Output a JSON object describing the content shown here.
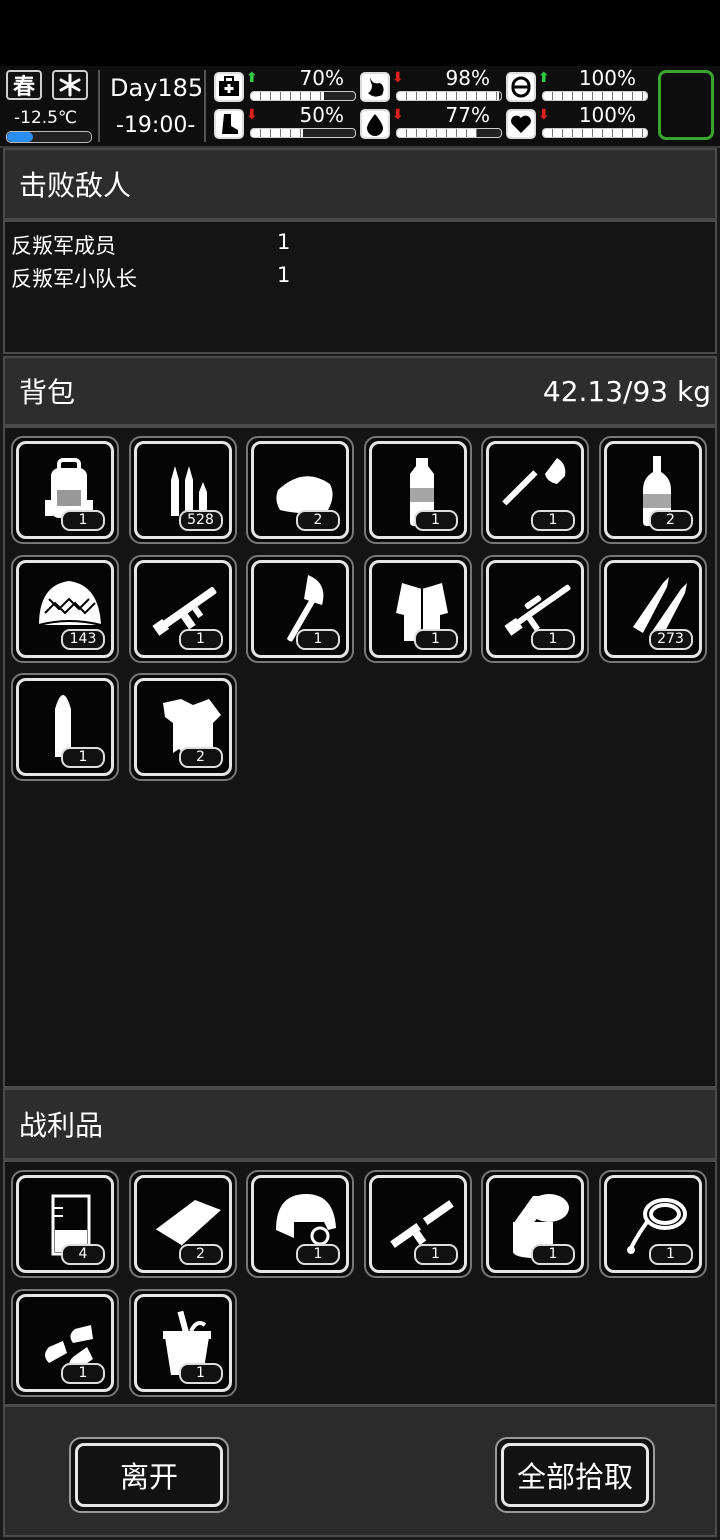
{
  "status": {
    "season": "春",
    "weather_icon": "snowflake-icon",
    "temperature": "-12.5℃",
    "day": "Day185",
    "time": "-19:00-",
    "stats": [
      {
        "icon": "medkit-icon",
        "trend": "up",
        "value": "70%",
        "level": 0.7
      },
      {
        "icon": "stomach-icon",
        "trend": "down",
        "value": "98%",
        "level": 0.98
      },
      {
        "icon": "pill-icon",
        "trend": "up",
        "value": "100%",
        "level": 1.0
      },
      {
        "icon": "boot-icon",
        "trend": "down",
        "value": "50%",
        "level": 0.5
      },
      {
        "icon": "water-drop-icon",
        "trend": "down",
        "value": "77%",
        "level": 0.77
      },
      {
        "icon": "heart-icon",
        "trend": "down",
        "value": "100%",
        "level": 1.0
      }
    ],
    "colors": {
      "up": "#2ecc40",
      "down": "#e0201c",
      "equip_border": "#3aa52e",
      "temp_fill": "#2c8df0"
    }
  },
  "defeated": {
    "title": "击败敌人",
    "enemies": [
      {
        "name": "反叛军成员",
        "count": "1"
      },
      {
        "name": "反叛军小队长",
        "count": "1"
      }
    ]
  },
  "backpack": {
    "title": "背包",
    "weight": "42.13/93 kg",
    "items": [
      {
        "icon": "backpack-icon",
        "count": "1"
      },
      {
        "icon": "rifle-ammo-icon",
        "count": "528"
      },
      {
        "icon": "bread-icon",
        "count": "2"
      },
      {
        "icon": "water-bottle-icon",
        "count": "1"
      },
      {
        "icon": "shovel-icon",
        "count": "1"
      },
      {
        "icon": "liquor-bottle-icon",
        "count": "2"
      },
      {
        "icon": "camo-net-helmet-icon",
        "count": "143"
      },
      {
        "icon": "assault-rifle-icon",
        "count": "1"
      },
      {
        "icon": "axe-icon",
        "count": "1"
      },
      {
        "icon": "fur-coat-icon",
        "count": "1"
      },
      {
        "icon": "sniper-rifle-icon",
        "count": "1"
      },
      {
        "icon": "large-bullets-icon",
        "count": "273"
      },
      {
        "icon": "cartridge-icon",
        "count": "1"
      },
      {
        "icon": "ragged-shirt-icon",
        "count": "2"
      }
    ]
  },
  "loot": {
    "title": "战利品",
    "items": [
      {
        "icon": "beaker-icon",
        "count": "4"
      },
      {
        "icon": "cloth-icon",
        "count": "2"
      },
      {
        "icon": "combat-helmet-icon",
        "count": "1"
      },
      {
        "icon": "broken-rifle-icon",
        "count": "1"
      },
      {
        "icon": "paper-roll-icon",
        "count": "1"
      },
      {
        "icon": "rope-icon",
        "count": "1"
      },
      {
        "icon": "bullet-tips-icon",
        "count": "1"
      },
      {
        "icon": "bucket-icon",
        "count": "1"
      }
    ]
  },
  "actions": {
    "leave": "离开",
    "take_all": "全部拾取"
  }
}
